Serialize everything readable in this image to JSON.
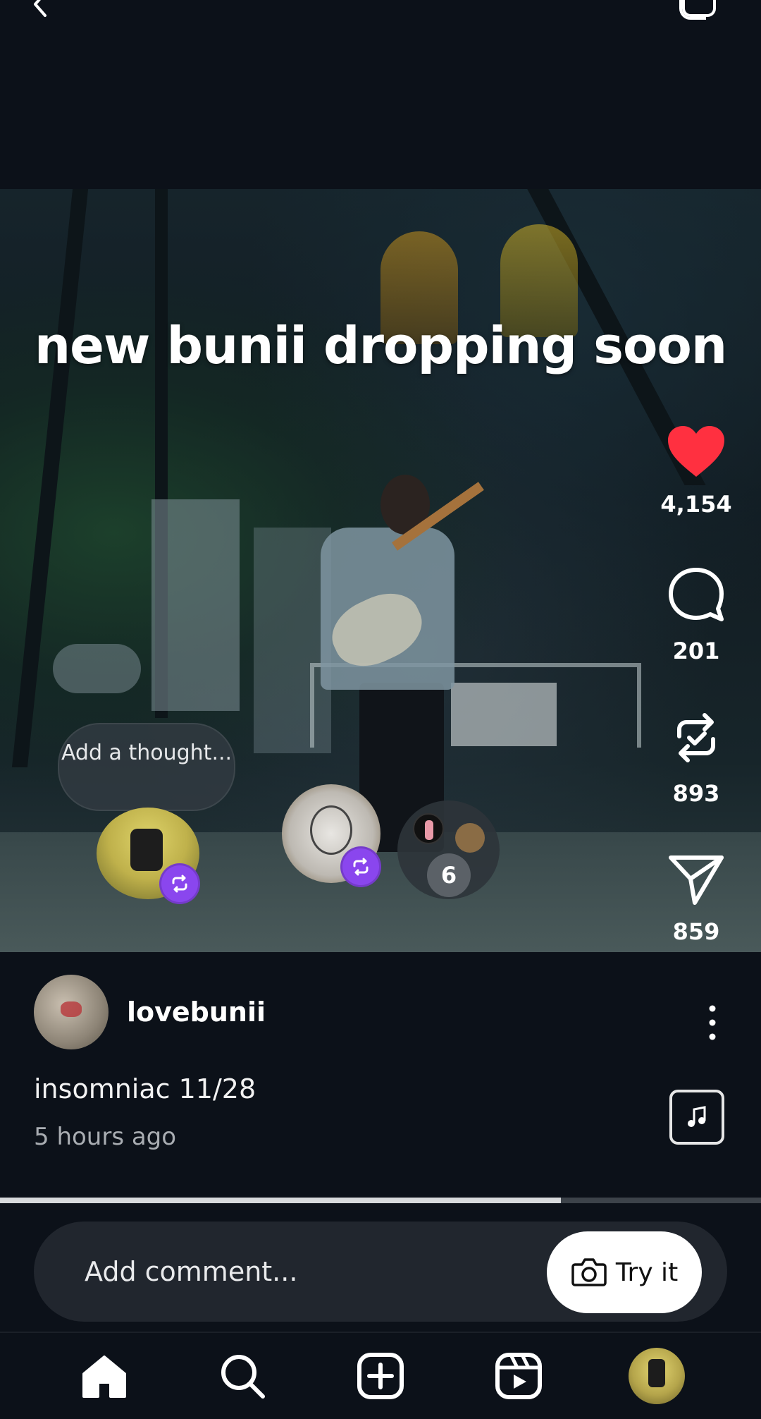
{
  "post": {
    "overlay_text": "new bunii dropping soon",
    "username": "lovebunii",
    "caption": "insomniac 11/28",
    "timestamp": "5 hours ago"
  },
  "actions": {
    "likes": "4,154",
    "comments": "201",
    "reposts": "893",
    "shares": "859"
  },
  "thoughts": {
    "prompt": "Add a thought...",
    "more_count": "6"
  },
  "playback": {
    "progress_fraction": 0.737
  },
  "comment_bar": {
    "placeholder": "Add comment...",
    "try_label": "Try it"
  },
  "colors": {
    "background": "#0c1119",
    "like_red": "#ff3040",
    "repost_badge": "#8a46ee"
  },
  "icons": {
    "back": "back-arrow-icon",
    "top_right": "stack-icon",
    "like": "heart-filled-icon",
    "comment": "comment-bubble-icon",
    "repost": "repost-icon",
    "share": "send-icon",
    "more": "more-vertical-icon",
    "music": "music-note-icon",
    "camera": "camera-icon",
    "nav": [
      "home-icon",
      "search-icon",
      "create-icon",
      "reels-icon",
      "profile-avatar"
    ]
  }
}
